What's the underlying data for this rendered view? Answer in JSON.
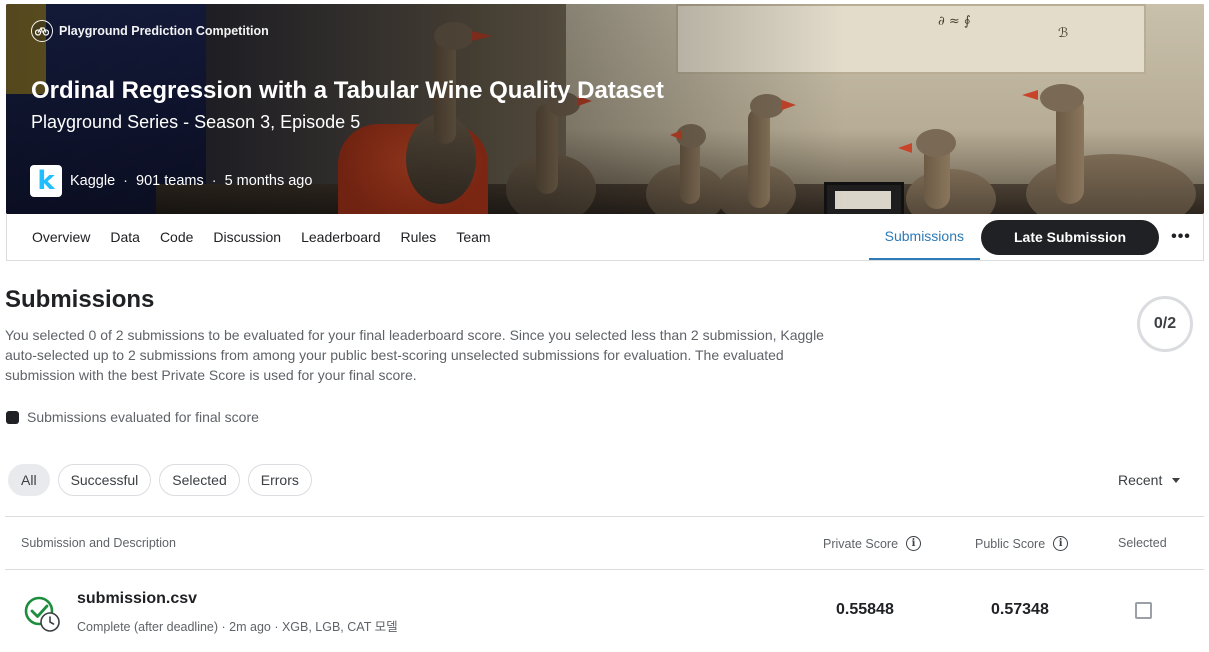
{
  "hero": {
    "competition_type": "Playground Prediction Competition",
    "title": "Ordinal Regression with a Tabular Wine Quality Dataset",
    "subtitle": "Playground Series - Season 3, Episode 5",
    "host": "Kaggle",
    "teams": "901 teams",
    "age": "5 months ago",
    "logo_letter": "k"
  },
  "nav": {
    "tabs": [
      "Overview",
      "Data",
      "Code",
      "Discussion",
      "Leaderboard",
      "Rules",
      "Team"
    ],
    "active_tab": "Submissions",
    "late_submission_label": "Late Submission",
    "more_label": "•••"
  },
  "submissions": {
    "title": "Submissions",
    "description": "You selected 0 of 2 submissions to be evaluated for your final leaderboard score. Since you selected less than 2 submission, Kaggle auto-selected up to 2 submissions from among your public best-scoring unselected submissions for evaluation. The evaluated submission with the best Private Score is used for your final score.",
    "counter": "0/2",
    "legend_label": "Submissions evaluated for final score",
    "filters": [
      "All",
      "Successful",
      "Selected",
      "Errors"
    ],
    "active_filter": "All",
    "sort_label": "Recent",
    "columns": {
      "submission": "Submission and Description",
      "private": "Private Score",
      "public": "Public Score",
      "selected": "Selected"
    },
    "rows": [
      {
        "file": "submission.csv",
        "meta": "Complete (after deadline) · 2m ago · XGB, LGB, CAT 모델",
        "private_score": "0.55848",
        "public_score": "0.57348",
        "selected": false
      }
    ]
  },
  "colors": {
    "accent": "#2c7ab6",
    "success": "#1e8e3e",
    "dark_button": "#202124"
  }
}
